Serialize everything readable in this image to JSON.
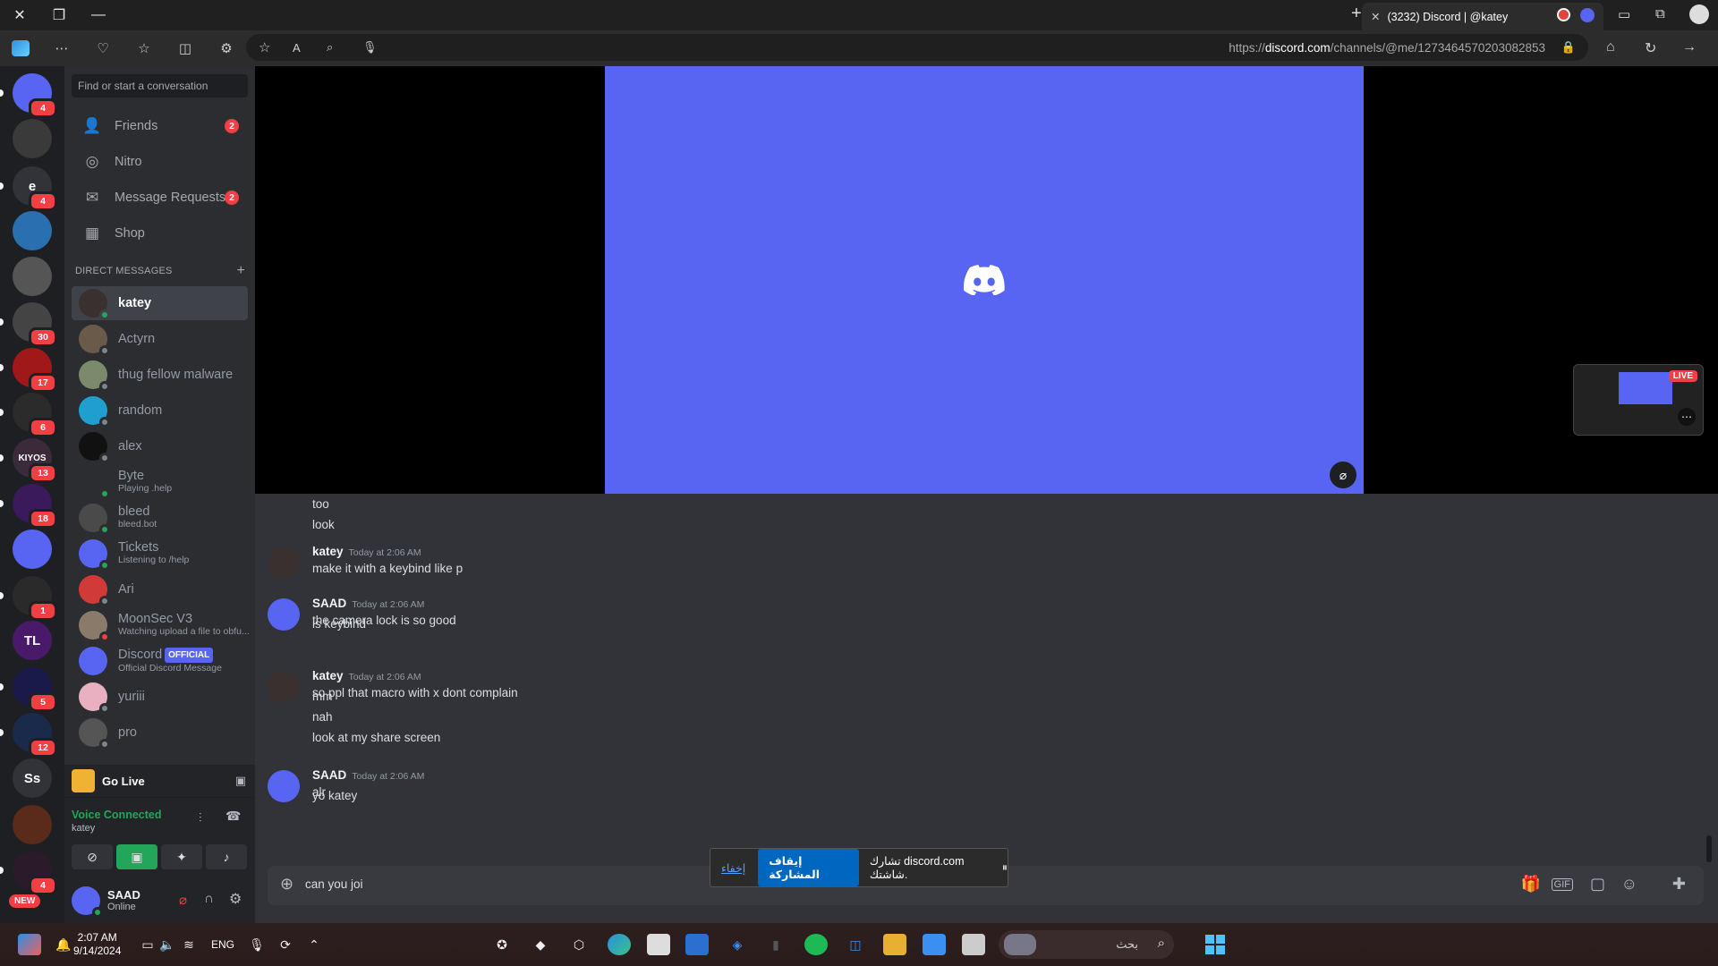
{
  "browser": {
    "tab_title": "(3232) Discord | @katey",
    "url_prefix": "https://",
    "url_domain": "discord.com",
    "url_path": "/channels/@me/1273464570203082853"
  },
  "rail": {
    "servers": [
      {
        "label": "",
        "badge": "4",
        "color": "#5865f2"
      },
      {
        "label": "",
        "badge": "",
        "color": "#3a3a3a"
      },
      {
        "label": "e",
        "badge": "4",
        "color": "#313338"
      },
      {
        "label": "",
        "badge": "",
        "color": "#2a6fb0"
      },
      {
        "label": "",
        "badge": "",
        "color": "#555"
      },
      {
        "label": "",
        "badge": "30",
        "color": "#444"
      },
      {
        "label": "",
        "badge": "17",
        "color": "#a01818"
      },
      {
        "label": "",
        "badge": "6",
        "color": "#2b2b2b"
      },
      {
        "label": "KIYOS",
        "badge": "13",
        "color": "#3a2a3a"
      },
      {
        "label": "",
        "badge": "18",
        "color": "#3a1a5a"
      },
      {
        "label": "",
        "badge": "",
        "color": "#5865f2"
      },
      {
        "label": "",
        "badge": "1",
        "color": "#2a2a2a"
      },
      {
        "label": "TL",
        "badge": "",
        "color": "#4a1a6a"
      },
      {
        "label": "",
        "badge": "5",
        "color": "#1a1a4a"
      },
      {
        "label": "",
        "badge": "12",
        "color": "#1a2a4a"
      },
      {
        "label": "Ss",
        "badge": "",
        "color": "#313338"
      },
      {
        "label": "",
        "badge": "",
        "color": "#5a2a1a"
      },
      {
        "label": "",
        "badge": "4",
        "color": "#2a1a2a"
      }
    ],
    "new_label": "NEW"
  },
  "sidebar": {
    "search_placeholder": "Find or start a conversation",
    "nav": [
      {
        "label": "Friends",
        "icon": "friends-icon",
        "badge": "2"
      },
      {
        "label": "Nitro",
        "icon": "nitro-icon",
        "badge": ""
      },
      {
        "label": "Message Requests",
        "icon": "mail-icon",
        "badge": "2"
      },
      {
        "label": "Shop",
        "icon": "shop-icon",
        "badge": ""
      }
    ],
    "dm_header": "DIRECT MESSAGES",
    "dms": [
      {
        "name": "katey",
        "sub": "",
        "status": "online",
        "active": true,
        "color": "#3a3030"
      },
      {
        "name": "Actyrn",
        "sub": "",
        "status": "offline",
        "active": false,
        "color": "#6a5a4a"
      },
      {
        "name": "thug fellow malware",
        "sub": "",
        "status": "offline",
        "active": false,
        "color": "#7a8a6a"
      },
      {
        "name": "random",
        "sub": "",
        "status": "offline",
        "active": false,
        "color": "#1e9fd0"
      },
      {
        "name": "alex",
        "sub": "",
        "status": "offline",
        "active": false,
        "color": "#111"
      },
      {
        "name": "Byte",
        "sub": "Playing .help",
        "status": "online",
        "active": false,
        "color": "#2b2d31"
      },
      {
        "name": "bleed",
        "sub": "bleed.bot",
        "status": "online",
        "active": false,
        "color": "#4a4a4a"
      },
      {
        "name": "Tickets",
        "sub": "Listening to /help",
        "status": "online",
        "active": false,
        "color": "#5865f2"
      },
      {
        "name": "Ari",
        "sub": "",
        "status": "offline",
        "active": false,
        "color": "#d23a3a"
      },
      {
        "name": "MoonSec V3",
        "sub": "Watching upload a file to obfu...",
        "status": "dnd",
        "active": false,
        "color": "#8a7a6a"
      },
      {
        "name": "Discord",
        "sub": "Official Discord Message",
        "status": "",
        "active": false,
        "color": "#5865f2",
        "official": "OFFICIAL"
      },
      {
        "name": "yuriii",
        "sub": "",
        "status": "offline",
        "active": false,
        "color": "#e8b0c0"
      },
      {
        "name": "pro",
        "sub": "",
        "status": "offline",
        "active": false,
        "color": "#555"
      }
    ],
    "go_live": "Go Live",
    "voice_title": "Voice Connected",
    "voice_sub": "katey",
    "user_name": "SAAD",
    "user_status": "Online"
  },
  "messages": [
    {
      "type": "cont",
      "text": "too"
    },
    {
      "type": "cont",
      "text": "look"
    },
    {
      "type": "head",
      "author": "katey",
      "time": "Today at 2:06 AM",
      "text": "make it with a keybind like p",
      "avatar": "#3a3030"
    },
    {
      "type": "head",
      "author": "SAAD",
      "time": "Today at 2:06 AM",
      "text": "the camera lock is so good",
      "avatar": "#5865f2"
    },
    {
      "type": "cont",
      "text": "is keybind"
    },
    {
      "type": "head",
      "author": "katey",
      "time": "Today at 2:06 AM",
      "text": "so ppl that macro with x dont complain",
      "avatar": "#3a3030"
    },
    {
      "type": "cont",
      "text": "mm"
    },
    {
      "type": "cont",
      "text": "nah"
    },
    {
      "type": "cont",
      "text": "look at my share screen"
    },
    {
      "type": "head",
      "author": "SAAD",
      "time": "Today at 2:06 AM",
      "text": "alr",
      "avatar": "#5865f2"
    },
    {
      "type": "cont",
      "text": "yo katey"
    }
  ],
  "composer": {
    "value": "can you joi"
  },
  "share_bar": {
    "text": "تشارك discord.com شاشتك.",
    "stop": "إيقاف المشاركة",
    "hide": "إخفاء"
  },
  "stream": {
    "live_label": "LIVE"
  },
  "taskbar": {
    "time": "2:07 AM",
    "date": "9/14/2024",
    "lang": "ENG",
    "search_placeholder": "بحث"
  }
}
